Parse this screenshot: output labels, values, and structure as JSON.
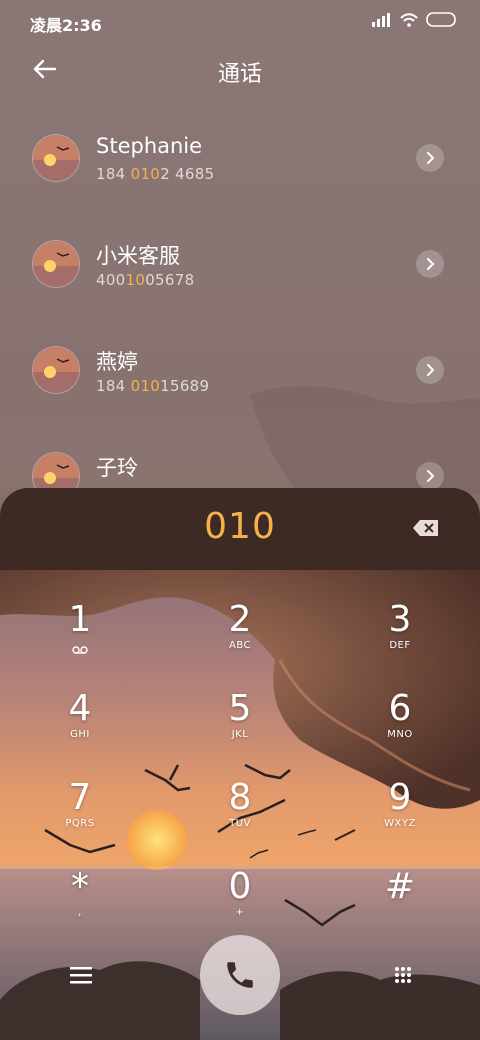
{
  "status_bar": {
    "time": "凌晨2:36"
  },
  "header": {
    "title": "通话"
  },
  "contacts": [
    {
      "name": "Stephanie",
      "num_pre": "184 ",
      "num_hl": "010",
      "num_post": "2 4685"
    },
    {
      "name": "小米客服",
      "num_pre": "400",
      "num_hl": "10",
      "num_post": "05678"
    },
    {
      "name": "燕婷",
      "num_pre": "184 ",
      "num_hl": "010",
      "num_post": "15689"
    },
    {
      "name": "子玲",
      "num_pre": "",
      "num_hl": "",
      "num_post": ""
    }
  ],
  "dialer": {
    "input": "010"
  },
  "keys": [
    {
      "digit": "1",
      "letters": ""
    },
    {
      "digit": "2",
      "letters": "ABC"
    },
    {
      "digit": "3",
      "letters": "DEF"
    },
    {
      "digit": "4",
      "letters": "GHI"
    },
    {
      "digit": "5",
      "letters": "JKL"
    },
    {
      "digit": "6",
      "letters": "MNO"
    },
    {
      "digit": "7",
      "letters": "PQRS"
    },
    {
      "digit": "8",
      "letters": "TUV"
    },
    {
      "digit": "9",
      "letters": "WXYZ"
    },
    {
      "digit": "*",
      "letters": ","
    },
    {
      "digit": "0",
      "letters": "+"
    },
    {
      "digit": "#",
      "letters": ""
    }
  ],
  "colors": {
    "accent": "#f4b14c",
    "panel": "#3e2a25"
  }
}
